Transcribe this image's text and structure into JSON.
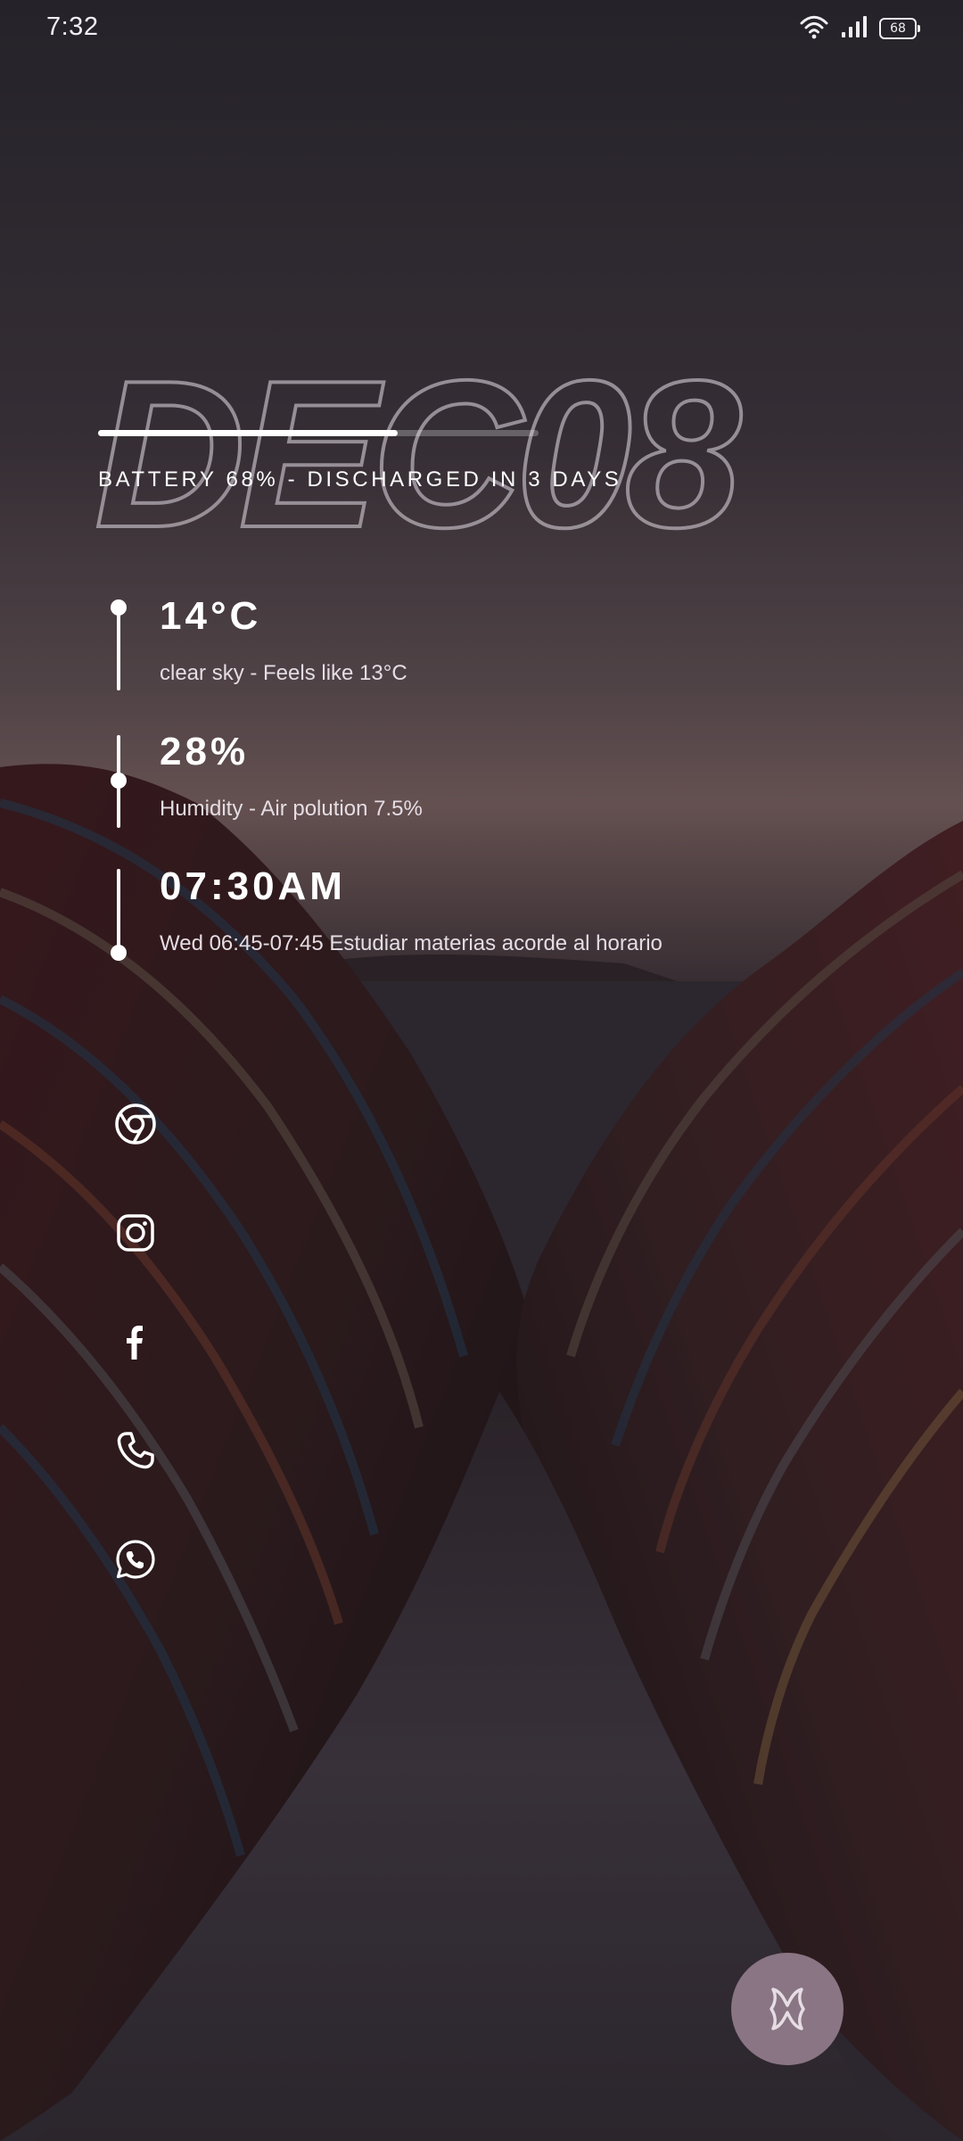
{
  "status_bar": {
    "time": "7:32",
    "battery_level": "68",
    "icons": [
      "wifi-icon",
      "signal-icon",
      "battery-icon"
    ]
  },
  "widget": {
    "date_outline": "DEC08",
    "battery_progress": 0.68,
    "battery_text": "BATTERY 68% - DISCHARGED IN 3 DAYS",
    "weather": {
      "title": "14°C",
      "subtitle": "clear sky - Feels like 13°C"
    },
    "humidity": {
      "title": "28%",
      "subtitle": "Humidity - Air polution 7.5%"
    },
    "alarm": {
      "title": "07:30AM",
      "subtitle": "Wed 06:45-07:45 Estudiar materias acorde al horario"
    }
  },
  "apps": [
    {
      "name": "Chrome",
      "icon": "chrome-icon"
    },
    {
      "name": "Instagram",
      "icon": "instagram-icon"
    },
    {
      "name": "Facebook",
      "icon": "facebook-icon"
    },
    {
      "name": "Phone",
      "icon": "phone-icon"
    },
    {
      "name": "WhatsApp",
      "icon": "whatsapp-icon"
    }
  ],
  "fab": {
    "icon": "launcher-logo-icon"
  },
  "colors": {
    "sky_top": "#3b3540",
    "sky_horizon": "#8a7070",
    "fab_background": "#8a7584",
    "text": "#ffffff"
  }
}
